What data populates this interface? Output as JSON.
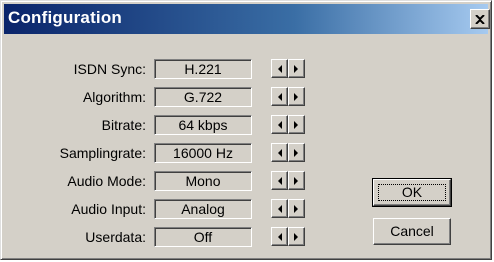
{
  "window": {
    "title": "Configuration"
  },
  "settings": [
    {
      "label": "ISDN Sync:",
      "value": "H.221"
    },
    {
      "label": "Algorithm:",
      "value": "G.722"
    },
    {
      "label": "Bitrate:",
      "value": "64 kbps"
    },
    {
      "label": "Samplingrate:",
      "value": "16000 Hz"
    },
    {
      "label": "Audio Mode:",
      "value": "Mono"
    },
    {
      "label": "Audio Input:",
      "value": "Analog"
    },
    {
      "label": "Userdata:",
      "value": "Off"
    }
  ],
  "buttons": {
    "ok": "OK",
    "cancel": "Cancel"
  },
  "colors": {
    "face": "#d4d0c8",
    "title_start": "#0a246a",
    "title_end": "#a6caf0"
  }
}
